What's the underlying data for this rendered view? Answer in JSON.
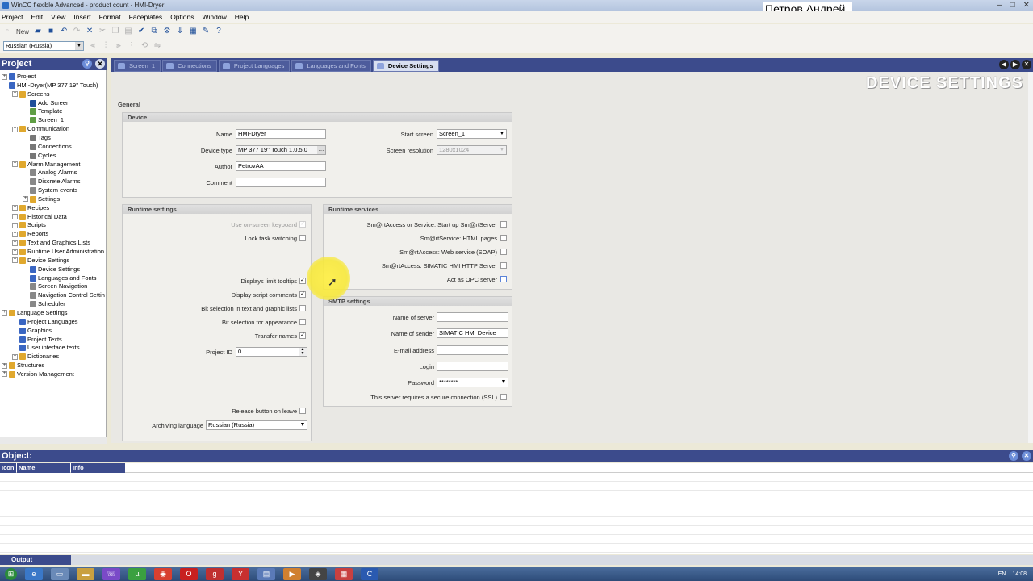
{
  "window": {
    "title": "WinCC flexible Advanced - product count - HMI-Dryer",
    "user_overlay": "Петров Андрей"
  },
  "menu": [
    "Project",
    "Edit",
    "View",
    "Insert",
    "Format",
    "Faceplates",
    "Options",
    "Window",
    "Help"
  ],
  "toolbar": {
    "new_label": "New",
    "language_select": "Russian (Russia)"
  },
  "project_panel": {
    "title": "Project",
    "tree": [
      {
        "label": "Project",
        "depth": 0,
        "icon": "folder-icon",
        "color": "#3a66c2"
      },
      {
        "label": "HMI-Dryer(MP 377 19'' Touch)",
        "depth": 0,
        "icon": "device-icon",
        "color": "#3a66c2"
      },
      {
        "label": "Screens",
        "depth": 1,
        "icon": "folder-icon",
        "color": "#e0a82e"
      },
      {
        "label": "Add Screen",
        "depth": 2,
        "icon": "add-icon",
        "color": "#1f4f99"
      },
      {
        "label": "Template",
        "depth": 2,
        "icon": "screen-icon",
        "color": "#5f9e44"
      },
      {
        "label": "Screen_1",
        "depth": 2,
        "icon": "screen-icon",
        "color": "#5f9e44"
      },
      {
        "label": "Communication",
        "depth": 1,
        "icon": "folder-icon",
        "color": "#e0a82e"
      },
      {
        "label": "Tags",
        "depth": 2,
        "icon": "tag-icon",
        "color": "#777"
      },
      {
        "label": "Connections",
        "depth": 2,
        "icon": "connection-icon",
        "color": "#777"
      },
      {
        "label": "Cycles",
        "depth": 2,
        "icon": "cycle-icon",
        "color": "#777"
      },
      {
        "label": "Alarm Management",
        "depth": 1,
        "icon": "folder-icon",
        "color": "#e0a82e"
      },
      {
        "label": "Analog Alarms",
        "depth": 2,
        "icon": "alarm-icon",
        "color": "#888"
      },
      {
        "label": "Discrete Alarms",
        "depth": 2,
        "icon": "alarm-icon",
        "color": "#888"
      },
      {
        "label": "System events",
        "depth": 2,
        "icon": "alarm-icon",
        "color": "#888"
      },
      {
        "label": "Settings",
        "depth": 2,
        "icon": "folder-icon",
        "color": "#e0a82e"
      },
      {
        "label": "Recipes",
        "depth": 1,
        "icon": "folder-icon",
        "color": "#e0a82e"
      },
      {
        "label": "Historical Data",
        "depth": 1,
        "icon": "folder-icon",
        "color": "#e0a82e"
      },
      {
        "label": "Scripts",
        "depth": 1,
        "icon": "folder-icon",
        "color": "#e0a82e"
      },
      {
        "label": "Reports",
        "depth": 1,
        "icon": "folder-icon",
        "color": "#e0a82e"
      },
      {
        "label": "Text and Graphics Lists",
        "depth": 1,
        "icon": "folder-icon",
        "color": "#e0a82e"
      },
      {
        "label": "Runtime User Administration",
        "depth": 1,
        "icon": "folder-icon",
        "color": "#e0a82e"
      },
      {
        "label": "Device Settings",
        "depth": 1,
        "icon": "folder-icon",
        "color": "#e0a82e"
      },
      {
        "label": "Device Settings",
        "depth": 2,
        "icon": "settings-icon",
        "color": "#3a66c2"
      },
      {
        "label": "Languages and Fonts",
        "depth": 2,
        "icon": "globe-icon",
        "color": "#3a66c2"
      },
      {
        "label": "Screen Navigation",
        "depth": 2,
        "icon": "navigation-icon",
        "color": "#888"
      },
      {
        "label": "Navigation Control Settin",
        "depth": 2,
        "icon": "navigation-icon",
        "color": "#888"
      },
      {
        "label": "Scheduler",
        "depth": 2,
        "icon": "scheduler-icon",
        "color": "#888"
      },
      {
        "label": "Language Settings",
        "depth": 0,
        "icon": "folder-icon",
        "color": "#e0a82e"
      },
      {
        "label": "Project Languages",
        "depth": 1,
        "icon": "globe-icon",
        "color": "#3a66c2"
      },
      {
        "label": "Graphics",
        "depth": 1,
        "icon": "graphics-icon",
        "color": "#3a66c2"
      },
      {
        "label": "Project Texts",
        "depth": 1,
        "icon": "text-icon",
        "color": "#3a66c2"
      },
      {
        "label": "User interface texts",
        "depth": 1,
        "icon": "text-icon",
        "color": "#3a66c2"
      },
      {
        "label": "Dictionaries",
        "depth": 1,
        "icon": "folder-icon",
        "color": "#e0a82e"
      },
      {
        "label": "Structures",
        "depth": 0,
        "icon": "folder-icon",
        "color": "#e0a82e"
      },
      {
        "label": "Version Management",
        "depth": 0,
        "icon": "folder-icon",
        "color": "#e0a82e"
      }
    ]
  },
  "tabs": [
    {
      "label": "Screen_1",
      "active": false
    },
    {
      "label": "Connections",
      "active": false
    },
    {
      "label": "Project Languages",
      "active": false
    },
    {
      "label": "Languages and Fonts",
      "active": false
    },
    {
      "label": "Device Settings",
      "active": true
    }
  ],
  "editor": {
    "heading": "DEVICE SETTINGS",
    "general": "General",
    "device": {
      "title": "Device",
      "name_label": "Name",
      "name": "HMI-Dryer",
      "device_type_label": "Device type",
      "device_type": "MP 377 19'' Touch 1.0.5.0",
      "author_label": "Author",
      "author": "PetrovAA",
      "comment_label": "Comment",
      "comment": "",
      "start_screen_label": "Start screen",
      "start_screen": "Screen_1",
      "resolution_label": "Screen resolution",
      "resolution": "1280x1024"
    },
    "runtime_settings": {
      "title": "Runtime settings",
      "onscreen_keyboard": "Use on-screen keyboard",
      "lock_task": "Lock task switching",
      "limit_tooltips": "Displays limit tooltips",
      "script_comments": "Display script comments",
      "bit_selection_text": "Bit selection in text and graphic lists",
      "bit_selection_appearance": "Bit selection for appearance",
      "transfer_names": "Transfer names",
      "project_id_label": "Project ID",
      "project_id": "0",
      "release_button": "Release button on leave",
      "archiving_language_label": "Archiving language",
      "archiving_language": "Russian (Russia)"
    },
    "runtime_services": {
      "title": "Runtime services",
      "smartaccess": "Sm@rtAccess or Service: Start up Sm@rtServer",
      "html_pages": "Sm@rtService: HTML pages",
      "web_service": "Sm@rtAccess: Web service (SOAP)",
      "http_server": "Sm@rtAccess: SIMATIC HMI HTTP Server",
      "opc_server": "Act as OPC server"
    },
    "smtp": {
      "title": "SMTP settings",
      "server_label": "Name of server",
      "server": "",
      "sender_label": "Name of sender",
      "sender": "SIMATIC HMI Device",
      "email_label": "E-mail address",
      "email": "",
      "login_label": "Login",
      "login": "",
      "password_label": "Password",
      "password": "********",
      "ssl_label": "This server requires a secure connection (SSL)"
    }
  },
  "object_panel": {
    "title": "Object:",
    "columns": [
      "Icon",
      "Name",
      "Info"
    ]
  },
  "output": {
    "label": "Output"
  },
  "tray": {
    "lang": "EN",
    "time": "14:08"
  }
}
